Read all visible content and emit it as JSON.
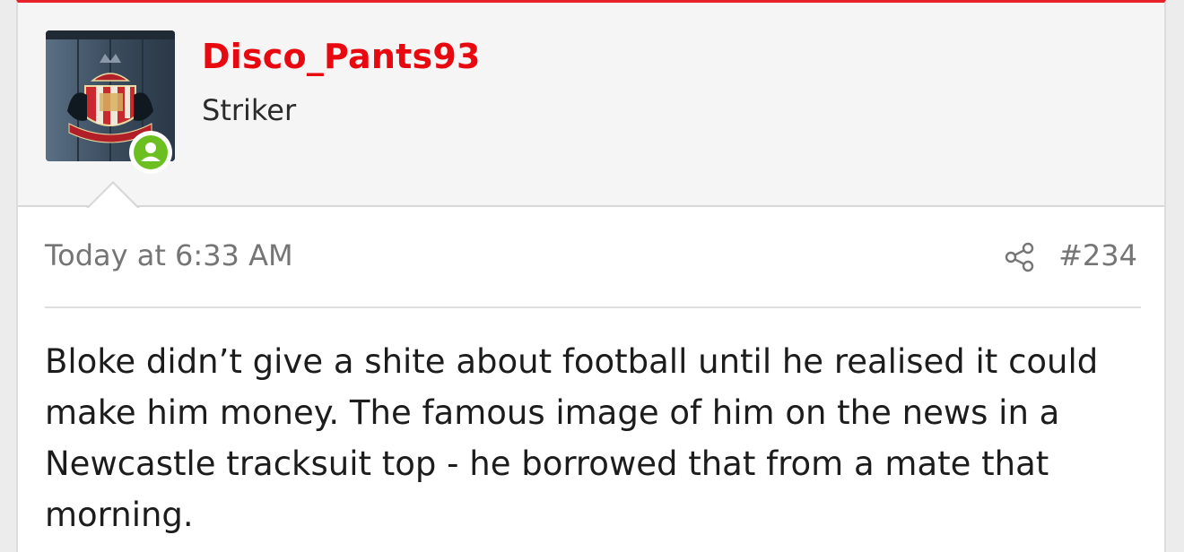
{
  "post": {
    "username": "Disco_Pants93",
    "user_title": "Striker",
    "timestamp": "Today at 6:33 AM",
    "post_number": "#234",
    "message": "Bloke didn’t give a shite about football until he realised it could make him money. The famous image of him on the news in a Newcastle tracksuit top - he borrowed that from a mate that morning."
  },
  "icons": {
    "share": "share-icon",
    "online": "user-online-icon"
  },
  "colors": {
    "accent": "#e8202a",
    "username": "#e8080f",
    "online": "#6cbf21"
  }
}
